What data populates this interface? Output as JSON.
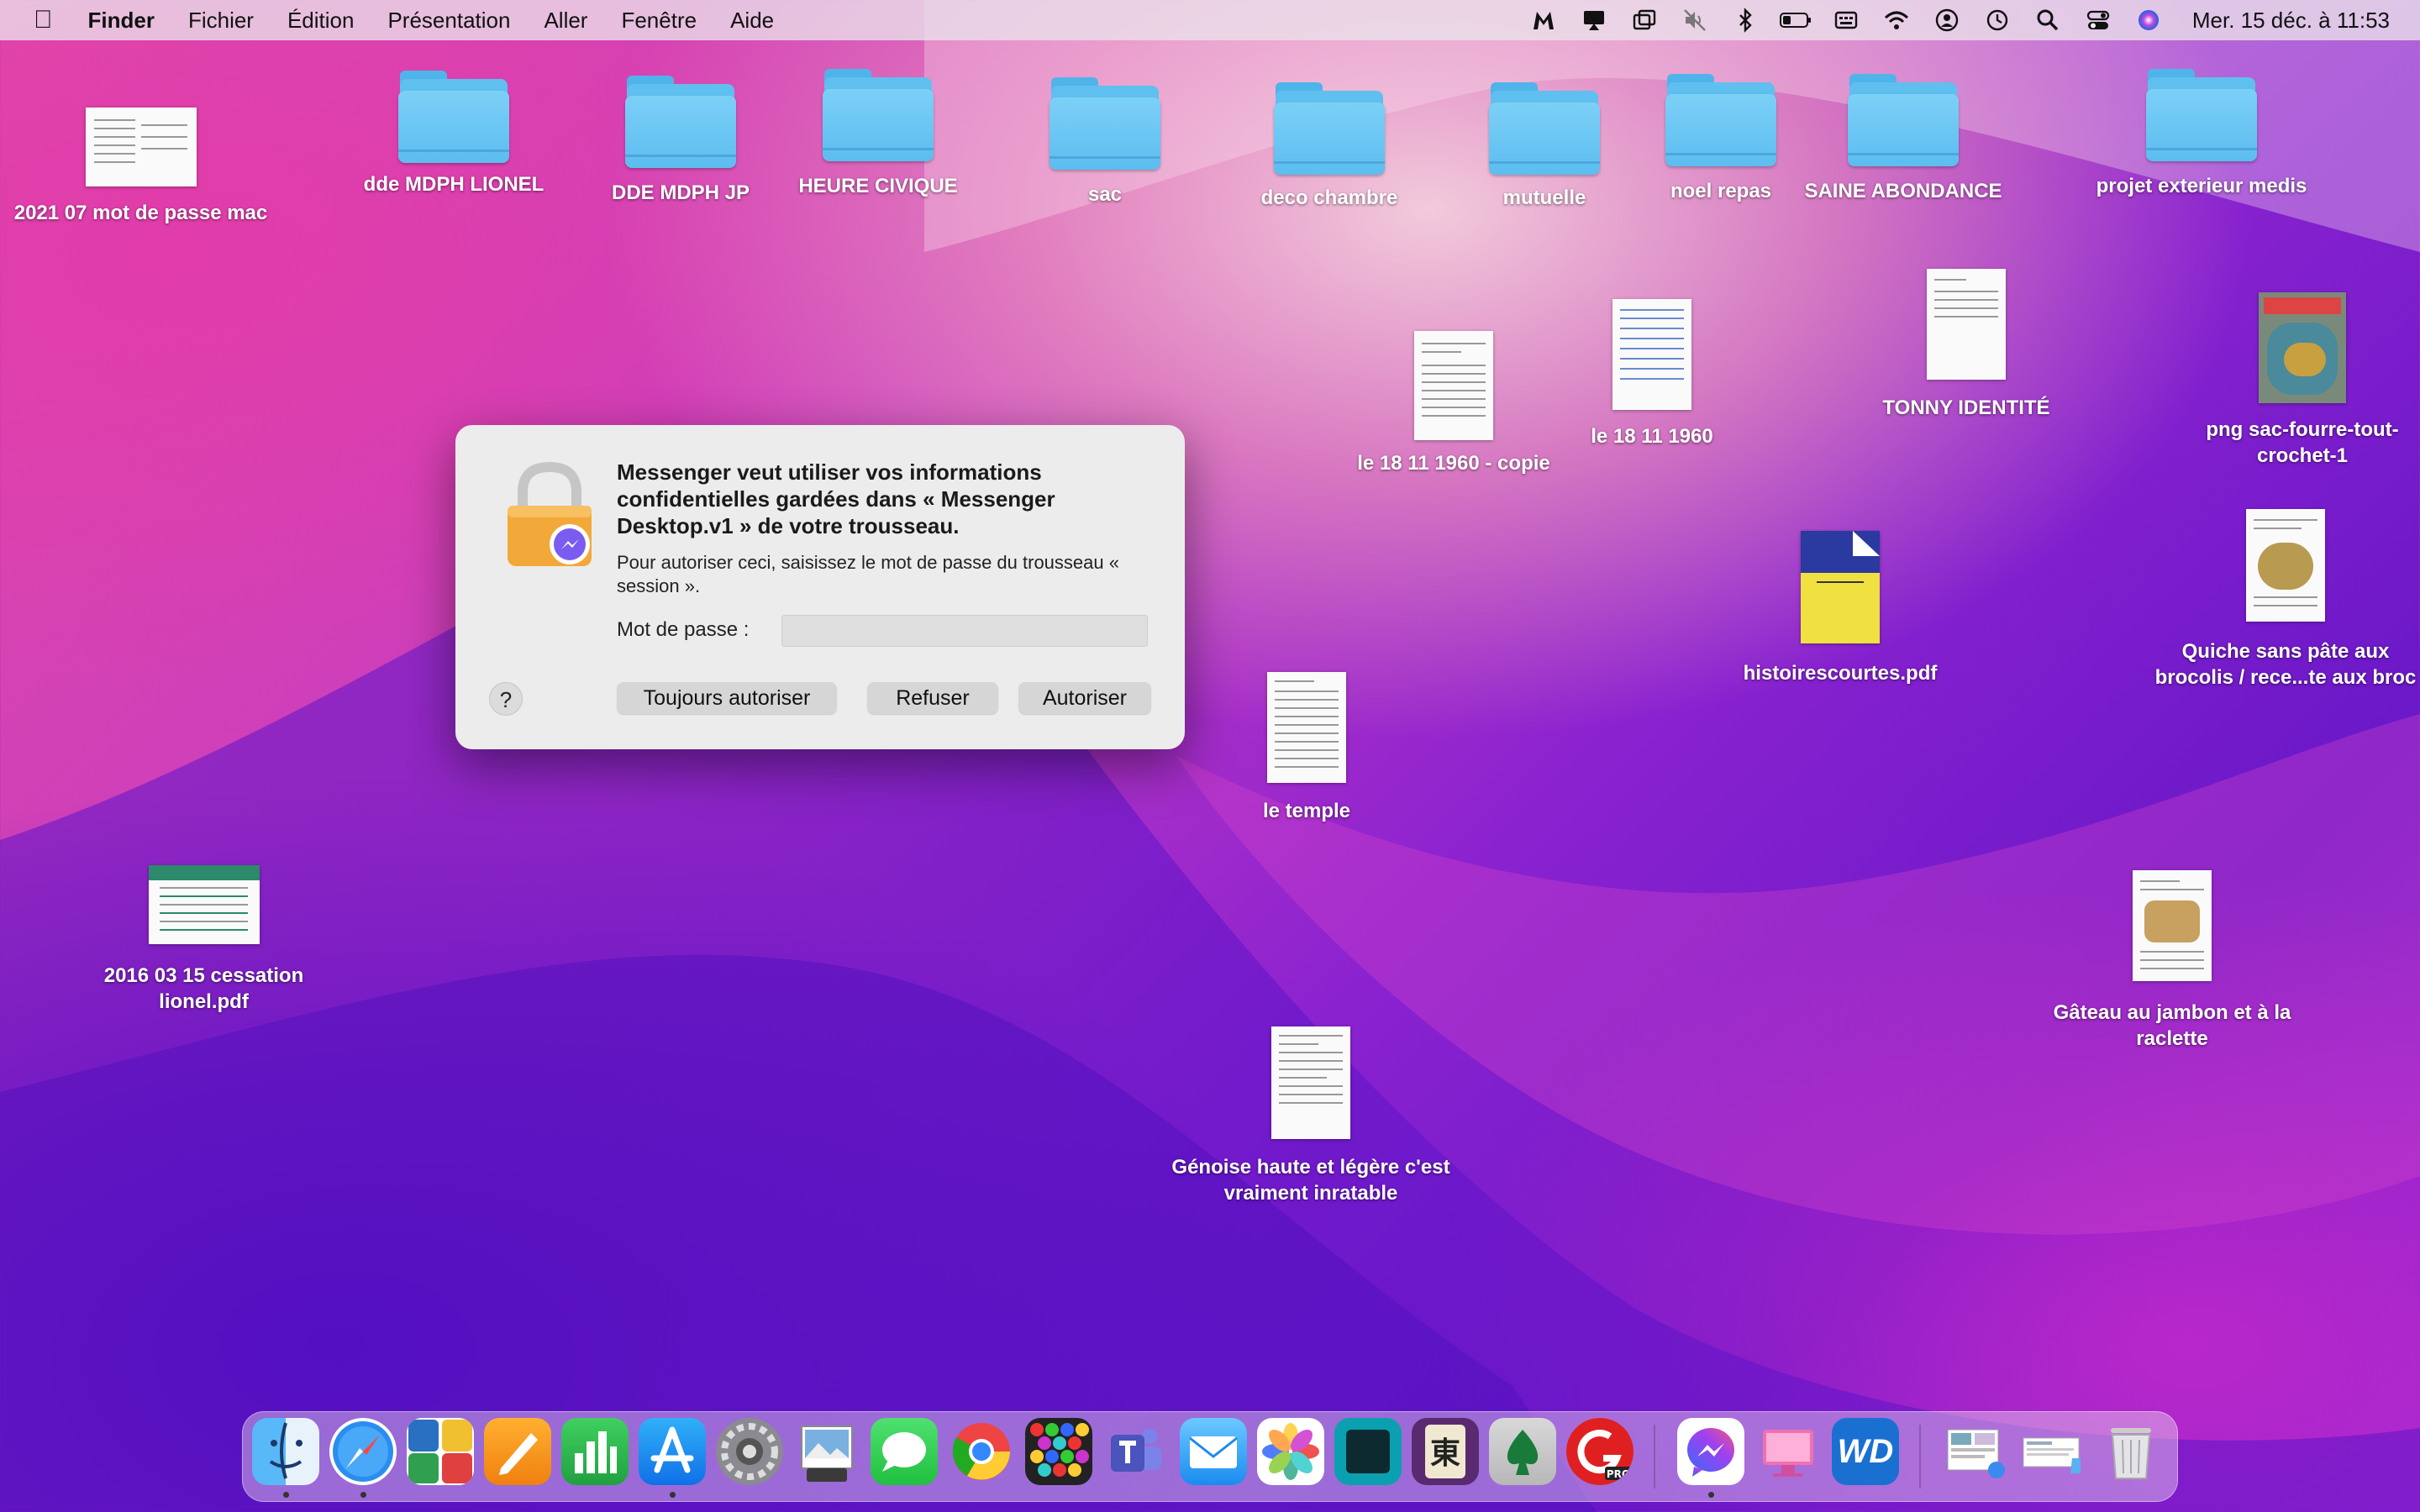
{
  "menubar": {
    "apple_glyph": "",
    "app": "Finder",
    "items": [
      "Fichier",
      "Édition",
      "Présentation",
      "Aller",
      "Fenêtre",
      "Aide"
    ],
    "clock": "Mer. 15 déc. à  11:53",
    "status_icons": [
      "malwarebytes-icon",
      "airplay-icon",
      "screens-icon",
      "mute-icon",
      "bluetooth-icon",
      "battery-icon",
      "keyboard-icon",
      "wifi-icon",
      "user-icon",
      "time-machine-icon",
      "search-icon",
      "control-center-icon",
      "siri-icon"
    ]
  },
  "desktop": {
    "folders": [
      {
        "label": "dde MDPH LIONEL"
      },
      {
        "label": "DDE MDPH JP"
      },
      {
        "label": "HEURE CIVIQUE"
      },
      {
        "label": "sac"
      },
      {
        "label": "deco chambre"
      },
      {
        "label": "mutuelle"
      },
      {
        "label": "noel repas"
      },
      {
        "label": "SAINE ABONDANCE"
      },
      {
        "label": "projet exterieur medis"
      }
    ],
    "files": [
      {
        "label": "2021 07 mot de passe mac"
      },
      {
        "label": "le 18 11 1960 - copie"
      },
      {
        "label": "le 18 11 1960"
      },
      {
        "label": "TONNY IDENTITÉ"
      },
      {
        "label": "png sac-fourre-tout-crochet-1"
      },
      {
        "label": "histoirescourtes.pdf"
      },
      {
        "label": "Quiche sans pâte aux brocolis / rece...te aux broc"
      },
      {
        "label": "le temple"
      },
      {
        "label": "2016 03 15 cessation lionel.pdf"
      },
      {
        "label": "Gâteau au jambon et à la raclette"
      },
      {
        "label": "Génoise haute et légère c'est vraiment inratable"
      }
    ]
  },
  "dialog": {
    "title": "Messenger veut utiliser vos informations confidentielles gardées dans « Messenger Desktop.v1 » de votre trousseau.",
    "description": "Pour autoriser ceci, saisissez le mot de passe du trousseau « session ».",
    "password_label": "Mot de passe :",
    "password_value": "",
    "help": "?",
    "buttons": {
      "always": "Toujours autoriser",
      "deny": "Refuser",
      "allow": "Autoriser"
    }
  },
  "dock": {
    "apps": [
      "Finder",
      "Safari",
      "Soulver",
      "Pages",
      "Numbers",
      "App Store",
      "Préférences Système",
      "Aperçu",
      "Messages",
      "Google Chrome",
      "Jeu de bulles",
      "Microsoft Teams",
      "Mail",
      "Photos",
      "Terminal",
      "Mahjong",
      "Solitaire",
      "Antidote",
      "Messenger",
      "CleanMyMac",
      "WD Discovery",
      "Téléchargements",
      "Dossier",
      "Corbeille"
    ],
    "wd_text": "WD",
    "pro_text": "PRO"
  },
  "colors": {
    "accent": "#5fc0f0",
    "dialog_bg": "#ececec"
  }
}
